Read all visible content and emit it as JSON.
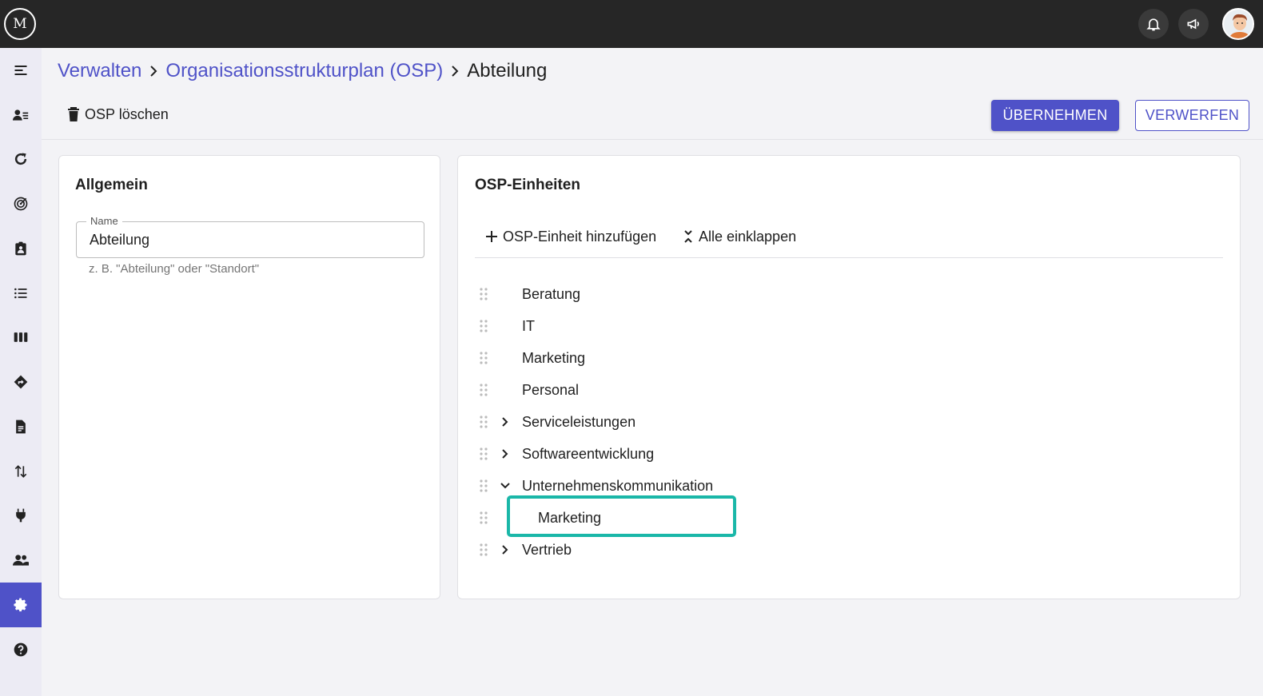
{
  "app": {
    "logo_text": "M"
  },
  "topbar": {
    "icons": [
      "bell-icon",
      "megaphone-icon",
      "user-avatar"
    ]
  },
  "sidebar": {
    "items": [
      {
        "icon": "menu-icon"
      },
      {
        "icon": "user-list-icon"
      },
      {
        "icon": "refresh-cycle-icon"
      },
      {
        "icon": "target-icon"
      },
      {
        "icon": "badge-icon"
      },
      {
        "icon": "list-icon"
      },
      {
        "icon": "columns-icon"
      },
      {
        "icon": "route-icon"
      },
      {
        "icon": "document-icon"
      },
      {
        "icon": "transfer-icon"
      },
      {
        "icon": "plug-icon"
      },
      {
        "icon": "people-icon"
      },
      {
        "icon": "gear-icon",
        "active": true
      },
      {
        "icon": "help-icon"
      }
    ],
    "accent": "#4f52c8"
  },
  "breadcrumb": {
    "items": [
      "Verwalten",
      "Organisationsstrukturplan (OSP)"
    ],
    "current": "Abteilung"
  },
  "actions": {
    "delete_label": "OSP löschen",
    "apply_label": "ÜBERNEHMEN",
    "discard_label": "VERWERFEN"
  },
  "general_card": {
    "title": "Allgemein",
    "name_label": "Name",
    "name_value": "Abteilung",
    "name_hint": "z. B. \"Abteilung\" oder \"Standort\""
  },
  "units_card": {
    "title": "OSP-Einheiten",
    "add_label": "OSP-Einheit hinzufügen",
    "collapse_label": "Alle einklappen",
    "tree": [
      {
        "label": "Beratung",
        "level": 0,
        "expander": "none"
      },
      {
        "label": "IT",
        "level": 0,
        "expander": "none"
      },
      {
        "label": "Marketing",
        "level": 0,
        "expander": "none"
      },
      {
        "label": "Personal",
        "level": 0,
        "expander": "none"
      },
      {
        "label": "Serviceleistungen",
        "level": 0,
        "expander": "collapsed"
      },
      {
        "label": "Softwareentwicklung",
        "level": 0,
        "expander": "collapsed"
      },
      {
        "label": "Unternehmenskommunikation",
        "level": 0,
        "expander": "expanded"
      },
      {
        "label": "Marketing",
        "level": 1,
        "expander": "none",
        "highlighted": true
      },
      {
        "label": "Vertrieb",
        "level": 0,
        "expander": "collapsed"
      }
    ]
  },
  "colors": {
    "primary": "#4f52c8",
    "highlight": "#1ab7a8",
    "topbar": "#262626"
  }
}
